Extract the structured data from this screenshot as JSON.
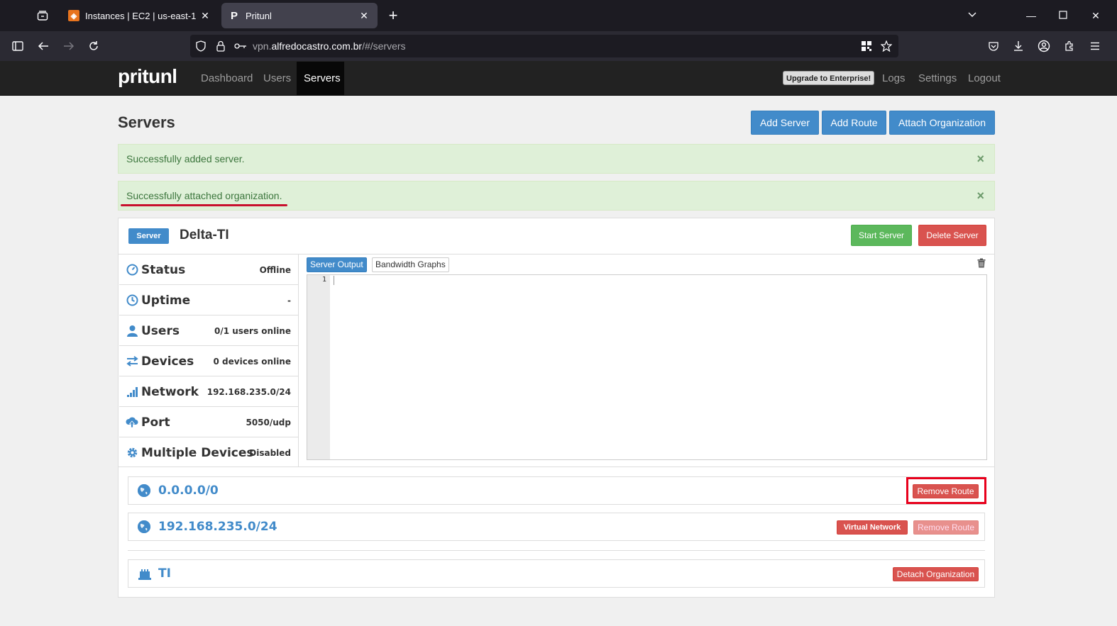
{
  "browser": {
    "tabs": [
      {
        "label": "Instances | EC2 | us-east-1",
        "active": false
      },
      {
        "label": "Pritunl",
        "active": true
      }
    ],
    "url_prefix": "vpn.",
    "url_domain": "alfredocastro.com.br",
    "url_path": "/#/servers"
  },
  "app": {
    "brand": "pritunl",
    "nav": [
      "Dashboard",
      "Users",
      "Servers"
    ],
    "active_nav": "Servers",
    "upgrade_label": "Upgrade to Enterprise!",
    "right_nav": [
      "Logs",
      "Settings",
      "Logout"
    ]
  },
  "page": {
    "title": "Servers",
    "buttons": {
      "add_server": "Add Server",
      "add_route": "Add Route",
      "attach_org": "Attach Organization"
    },
    "alerts": [
      "Successfully added server.",
      "Successfully attached organization."
    ],
    "alert_close": "×"
  },
  "server": {
    "badge": "Server",
    "name": "Delta-TI",
    "start_label": "Start Server",
    "delete_label": "Delete Server",
    "info": [
      {
        "label": "Status",
        "value": "Offline",
        "icon": "dashboard-icon"
      },
      {
        "label": "Uptime",
        "value": "-",
        "icon": "clock-icon"
      },
      {
        "label": "Users",
        "value": "0/1 users online",
        "icon": "user-icon"
      },
      {
        "label": "Devices",
        "value": "0 devices online",
        "icon": "transfer-icon"
      },
      {
        "label": "Network",
        "value": "192.168.235.0/24",
        "icon": "signal-icon"
      },
      {
        "label": "Port",
        "value": "5050/udp",
        "icon": "cloud-upload-icon"
      },
      {
        "label": "Multiple Devices",
        "value": "Disabled",
        "icon": "cog-icon"
      }
    ],
    "output_tabs": [
      "Server Output",
      "Bandwidth Graphs"
    ],
    "output_line": "1",
    "routes": [
      {
        "network": "0.0.0.0/0",
        "remove_label": "Remove Route"
      },
      {
        "network": "192.168.235.0/24",
        "virtual_label": "Virtual Network",
        "remove_label": "Remove Route"
      }
    ],
    "organization": {
      "name": "TI",
      "detach_label": "Detach Organization"
    }
  },
  "colors": {
    "primary": "#428bca",
    "success": "#5cb85c",
    "danger": "#d9534f",
    "annotation": "#e8001c"
  }
}
